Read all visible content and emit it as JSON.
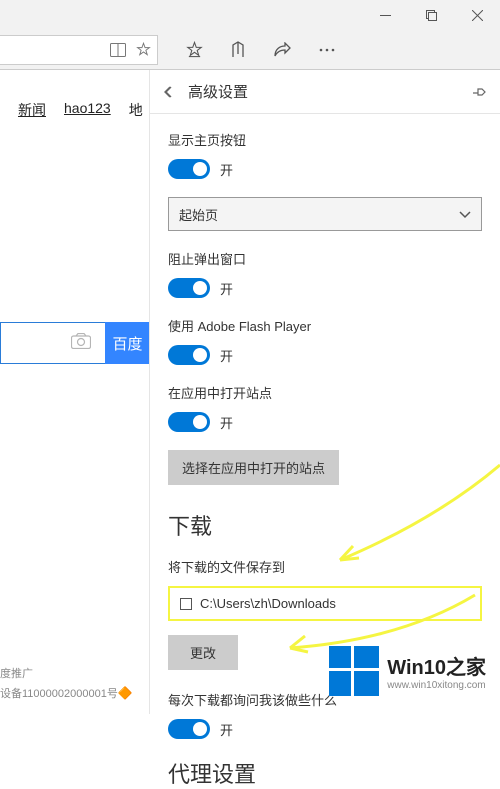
{
  "window": {
    "min": "minimize",
    "max": "maximize",
    "close": "close"
  },
  "left": {
    "links": [
      "新闻",
      "hao123"
    ],
    "cut": "地",
    "search_btn": "百度",
    "ad_line1": "度推广",
    "ad_line2": "设备11000002000001号"
  },
  "panel": {
    "title": "高级设置",
    "s1_label": "显示主页按钮",
    "s1_on": "开",
    "dropdown": "起始页",
    "s2_label": "阻止弹出窗口",
    "s2_on": "开",
    "s3_label": "使用 Adobe Flash Player",
    "s3_on": "开",
    "s4_label": "在应用中打开站点",
    "s4_on": "开",
    "open_sites_btn": "选择在应用中打开的站点",
    "download_h": "下载",
    "save_to_label": "将下载的文件保存到",
    "path": "C:\\Users\\zh\\Downloads",
    "change_btn": "更改",
    "ask_label": "每次下载都询问我该做些什么",
    "proxy_h": "代理设置"
  },
  "watermark": {
    "brand": "Win10",
    "suffix": "之家",
    "url": "www.win10xitong.com"
  }
}
